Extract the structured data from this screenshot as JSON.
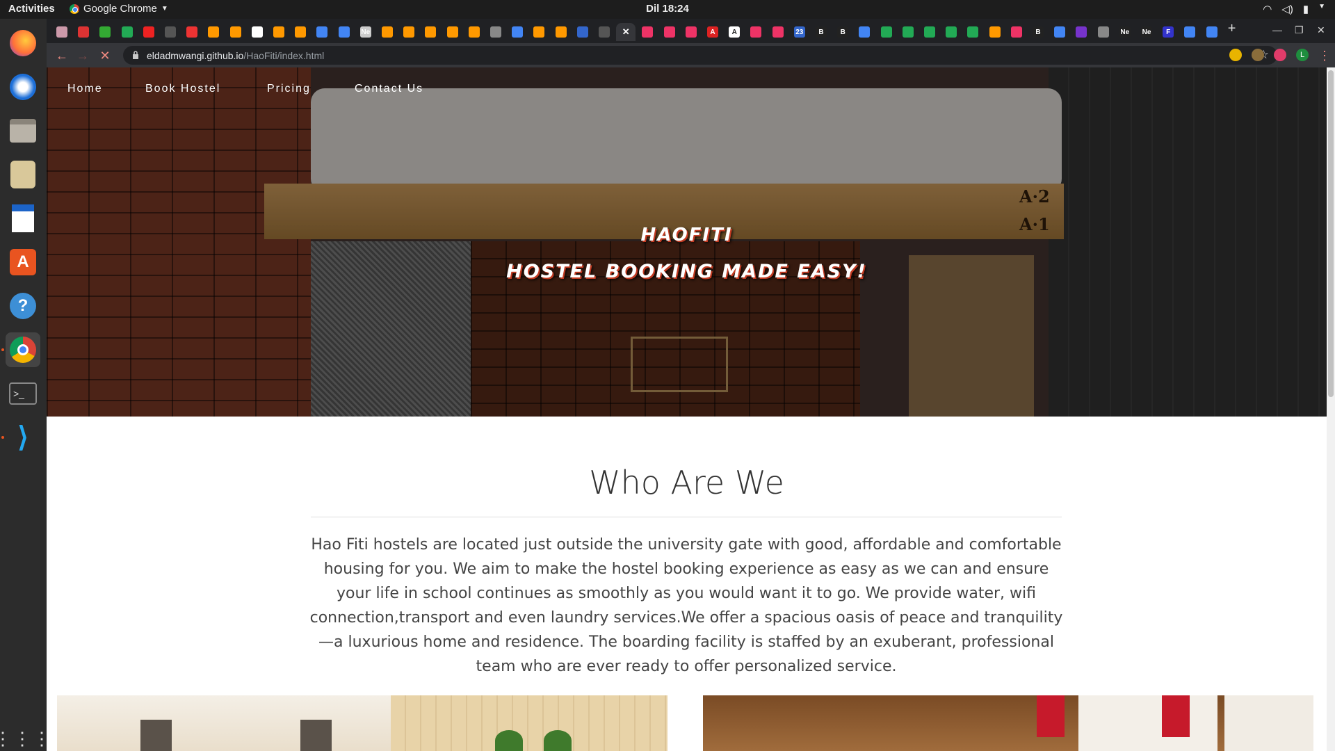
{
  "topbar": {
    "activities": "Activities",
    "app_name": "Google Chrome",
    "clock": "Dil 18:24"
  },
  "dock": {
    "items": [
      "firefox-icon",
      "thunderbird-icon",
      "files-icon",
      "rhythmbox-icon",
      "libreoffice-writer-icon",
      "software-center-icon",
      "help-icon",
      "chrome-icon",
      "terminal-icon",
      "vscode-icon",
      "app-grid-icon"
    ]
  },
  "browser": {
    "url_host": "eldadmwangi.github.io",
    "url_path": "/HaoFiti/index.html",
    "tab_favicons": [
      "#c9a",
      "#d33",
      "#3a3",
      "#2a5",
      "#e22",
      "#555",
      "#e33",
      "#f90",
      "#f90",
      "#fff",
      "#f90",
      "#f90",
      "#4285f4",
      "#4285f4",
      "#ccc",
      "#f90",
      "#f90",
      "#f90",
      "#f90",
      "#f90",
      "#888",
      "#4285f4",
      "#f90",
      "#f90",
      "#36c",
      "#555",
      "#e44",
      "#e36",
      "#e36",
      "#e36",
      "#d22",
      "#fff",
      "#e36",
      "#e36",
      "#36c",
      "#222",
      "#222",
      "#4285f4",
      "#2a5",
      "#2a5",
      "#2a5",
      "#2a5",
      "#2a5",
      "#f90",
      "#e36",
      "#222",
      "#4285f4",
      "#73c",
      "#888",
      "#222",
      "#222",
      "#33c",
      "#4285f4",
      "#4285f4"
    ],
    "tab_letters": [
      "",
      "",
      "",
      "",
      "",
      "",
      "",
      "",
      "",
      "",
      "",
      "",
      "",
      "",
      "Ne",
      "",
      "",
      "",
      "",
      "",
      "",
      "",
      "",
      "",
      "",
      "",
      "",
      "",
      "",
      "",
      "A",
      "A",
      "",
      "",
      "23",
      "B",
      "B",
      "",
      "",
      "",
      "",
      "",
      "",
      "",
      "",
      "B",
      "",
      "",
      "",
      "Ne",
      "Ne",
      "F",
      "",
      ""
    ],
    "new_tab": "+"
  },
  "site": {
    "nav": [
      "Home",
      "Book Hostel",
      "Pricing",
      "Contact Us"
    ],
    "hero_title": "HAOFITI",
    "hero_tagline": "HOSTEL BOOKING MADE EASY!",
    "plank_labels": [
      "A·2",
      "A·1"
    ],
    "about_title": "Who Are We",
    "about_text": "Hao Fiti hostels are located just outside the university gate with good, affordable and comfortable housing for you. We aim to make the hostel booking experience as easy as we can and ensure your life in school continues as smoothly as you would want it to go. We provide water, wifi connection,transport and even laundry services.We offer a spacious oasis of peace and tranquility—a luxurious home and residence. The boarding facility is staffed by an exuberant, professional team who are ever ready to offer personalized service."
  },
  "colors": {
    "topbar_bg": "#1d1d1d",
    "dock_bg": "#2c2c2c",
    "tabstrip_bg": "#202124",
    "toolbar_bg": "#35363a",
    "hero_text_shadow": "#c23b22"
  }
}
